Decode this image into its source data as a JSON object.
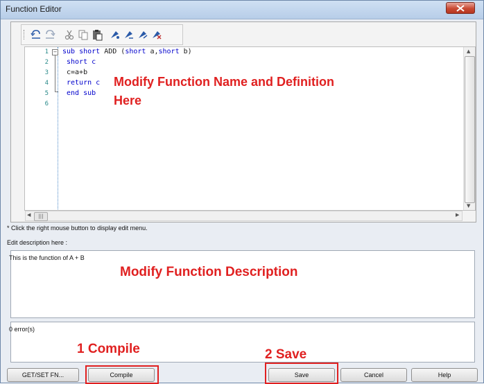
{
  "window": {
    "title": "Function Editor"
  },
  "toolbar": {
    "buttons": [
      "undo-icon",
      "redo-icon",
      "cut-icon",
      "copy-icon",
      "paste-icon",
      "tool-1-icon",
      "tool-2-icon",
      "tool-3-icon",
      "tool-4-icon"
    ]
  },
  "editor": {
    "line_numbers": [
      "1",
      "2",
      "3",
      "4",
      "5",
      "6"
    ],
    "lines": [
      "sub short ADD (short a,short b)",
      "short c",
      "c=a+b",
      "return c",
      "end sub",
      ""
    ],
    "hint": "* Click the right mouse button to display edit menu."
  },
  "description": {
    "label": "Edit description here :",
    "value": "This is the function of A + B"
  },
  "output": {
    "status": "0 error(s)"
  },
  "annotations": {
    "function_note": "Modify Function Name and Definition Here",
    "description_note": "Modify Function Description",
    "compile_note": "1 Compile",
    "save_note": "2 Save"
  },
  "buttons": {
    "getset": "GET/SET FN...",
    "compile": "Compile",
    "save": "Save",
    "cancel": "Cancel",
    "help": "Help"
  },
  "colors": {
    "annotation": "#e02020",
    "keyword": "#0000cc"
  }
}
